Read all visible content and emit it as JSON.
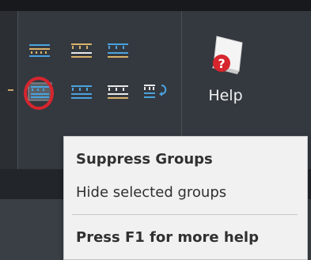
{
  "ribbon": {
    "tools": [
      {
        "icon": "group-table-icon"
      },
      {
        "icon": "group-table-icon"
      },
      {
        "icon": "group-table-icon"
      },
      {
        "icon": "suppress-groups-icon"
      },
      {
        "icon": "group-table-icon"
      },
      {
        "icon": "group-table-icon"
      },
      {
        "icon": "group-refresh-icon"
      }
    ],
    "help": {
      "label": "Help",
      "icon": "help-book-icon"
    }
  },
  "tooltip": {
    "title": "Suppress Groups",
    "description": "Hide selected groups",
    "help_hint": "Press F1 for more help"
  },
  "colors": {
    "ribbon_bg": "#343940",
    "tooltip_bg": "#f1f1f1",
    "highlight": "#d7252e",
    "icon_blue": "#4aa3df",
    "icon_gold": "#d9b26a"
  }
}
